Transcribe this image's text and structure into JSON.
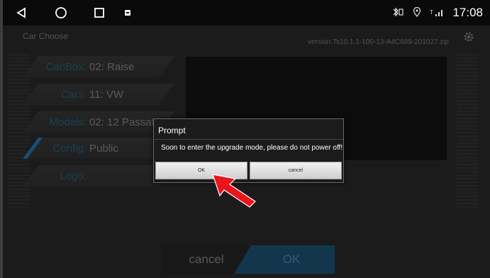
{
  "status_bar": {
    "clock": "17:08",
    "icons": [
      "back-icon",
      "home-icon",
      "recents-icon",
      "notification-icon",
      "bluetooth-icon",
      "location-icon",
      "signal-icon"
    ]
  },
  "app": {
    "title": "Car Choose",
    "version": "version:Ts10.1.1-100-13-A4C689-201027.zip",
    "rows": [
      {
        "label": "CanBox:",
        "value": "02: Raise"
      },
      {
        "label": "Cars:",
        "value": "11: VW"
      },
      {
        "label": "Models:",
        "value": "02: 12 Passat"
      },
      {
        "label": "Config:",
        "value": "Public"
      },
      {
        "label": "Logo:",
        "value": ""
      }
    ],
    "cancel_label": "cancel",
    "ok_label": "OK"
  },
  "dialog": {
    "title": "Prompt",
    "message": "Soon to enter the upgrade mode, please do not power off!",
    "ok_label": "OK",
    "cancel_label": "cancel"
  },
  "colors": {
    "accent": "#2b89c9",
    "annotation_arrow": "#e8161b"
  }
}
